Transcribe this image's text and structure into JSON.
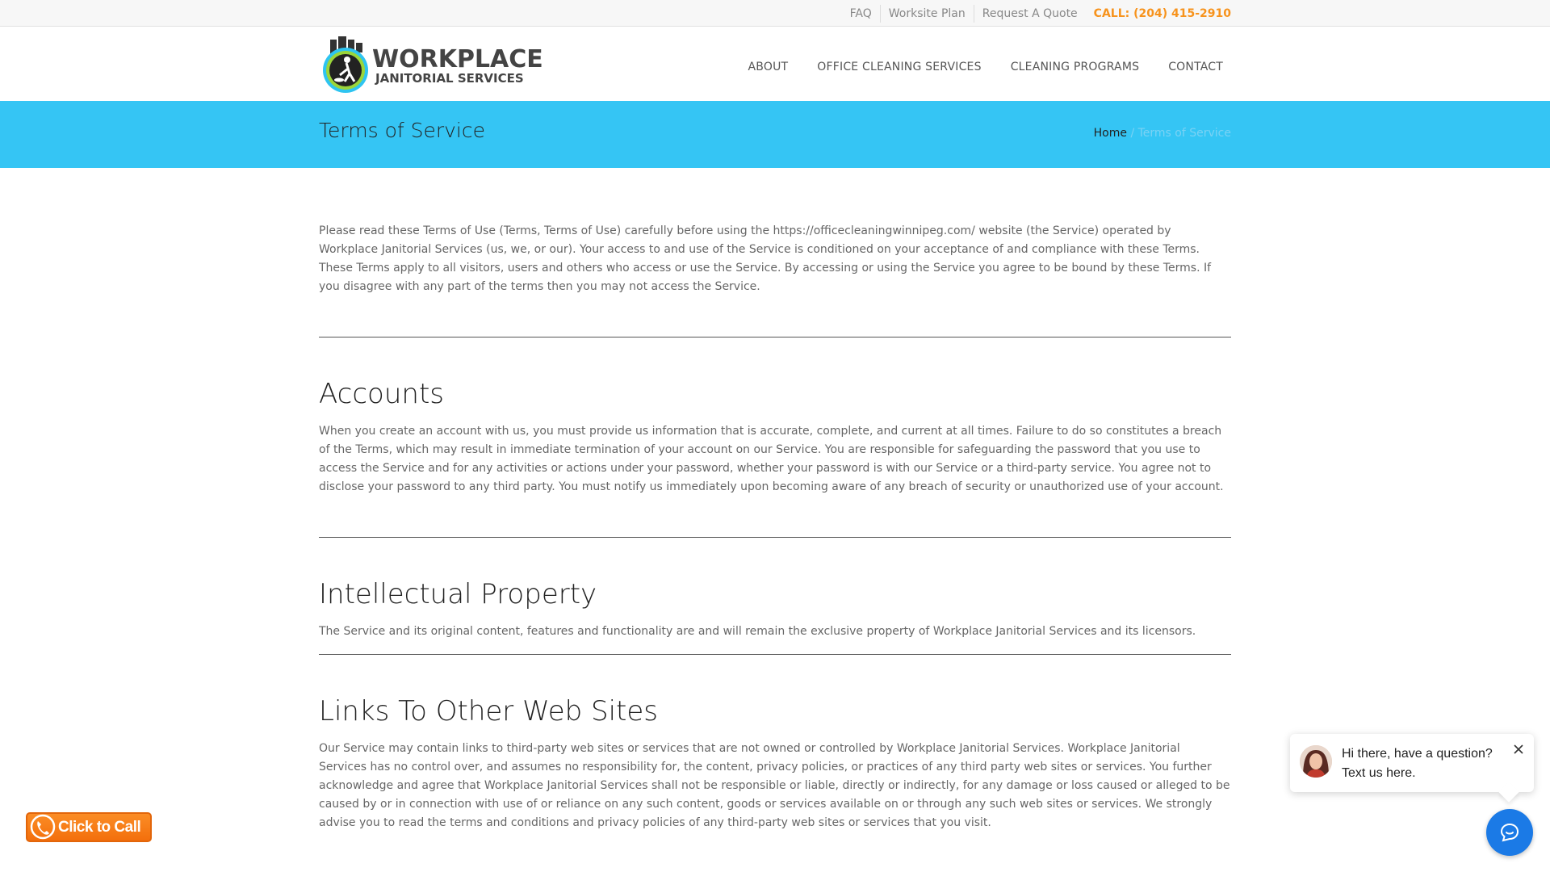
{
  "topbar": {
    "links": [
      "FAQ",
      "Worksite Plan",
      "Request A Quote"
    ],
    "phone": "CALL: (204) 415-2910"
  },
  "logo": {
    "line1": "WORKPLACE",
    "line2": "JANITORIAL SERVICES"
  },
  "nav": {
    "items": [
      "ABOUT",
      "OFFICE CLEANING SERVICES",
      "CLEANING PROGRAMS",
      "CONTACT"
    ]
  },
  "banner": {
    "title": "Terms of Service",
    "breadcrumb_home": "Home",
    "breadcrumb_sep": "/",
    "breadcrumb_current": "Terms of Service"
  },
  "content": {
    "intro": "Please read these Terms of Use (Terms, Terms of Use) carefully before using the https://officecleaningwinnipeg.com/ website (the Service) operated by Workplace Janitorial Services (us, we, or our). Your access to and use of the Service is conditioned on your acceptance of and compliance with these Terms. These Terms apply to all visitors, users and others who access or use the Service. By accessing or using the Service you agree to be bound by these Terms. If you disagree with any part of the terms then you may not access the Service.",
    "sections": [
      {
        "heading": "Accounts",
        "body": "When you create an account with us, you must provide us information that is accurate, complete, and current at all times. Failure to do so constitutes a breach of the Terms, which may result in immediate termination of your account on our Service. You are responsible for safeguarding the password that you use to access the Service and for any activities or actions under your password, whether your password is with our Service or a third-party service. You agree not to disclose your password to any third party. You must notify us immediately upon becoming aware of any breach of security or unauthorized use of your account."
      },
      {
        "heading": "Intellectual Property",
        "body": "The Service and its original content, features and functionality are and will remain the exclusive property of Workplace Janitorial Services and its licensors."
      },
      {
        "heading": "Links To Other Web Sites",
        "body": "Our Service may contain links to third-party web sites or services that are not owned or controlled by Workplace Janitorial Services. Workplace Janitorial Services has no control over, and assumes no responsibility for, the content, privacy policies, or practices of any third party web sites or services. You further acknowledge and agree that Workplace Janitorial Services shall not be responsible or liable, directly or indirectly, for any damage or loss caused or alleged to be caused by or in connection with use of or reliance on any such content, goods or services available on or through any such web sites or services. We strongly advise you to read the terms and conditions and privacy policies of any third-party web sites or services that you visit."
      }
    ]
  },
  "click_to_call": {
    "label": "Click to Call"
  },
  "chat": {
    "line1": "Hi there, have a question?",
    "line2": "Text us here."
  },
  "icons": {
    "logo": "janitor-mascot-icon",
    "call": "phone-icon",
    "close": "close-icon",
    "chat": "chat-bubble-icon"
  },
  "colors": {
    "banner": "#35c5f4",
    "phone_accent": "#f7931d",
    "chat_launcher": "#1b7ae6"
  }
}
